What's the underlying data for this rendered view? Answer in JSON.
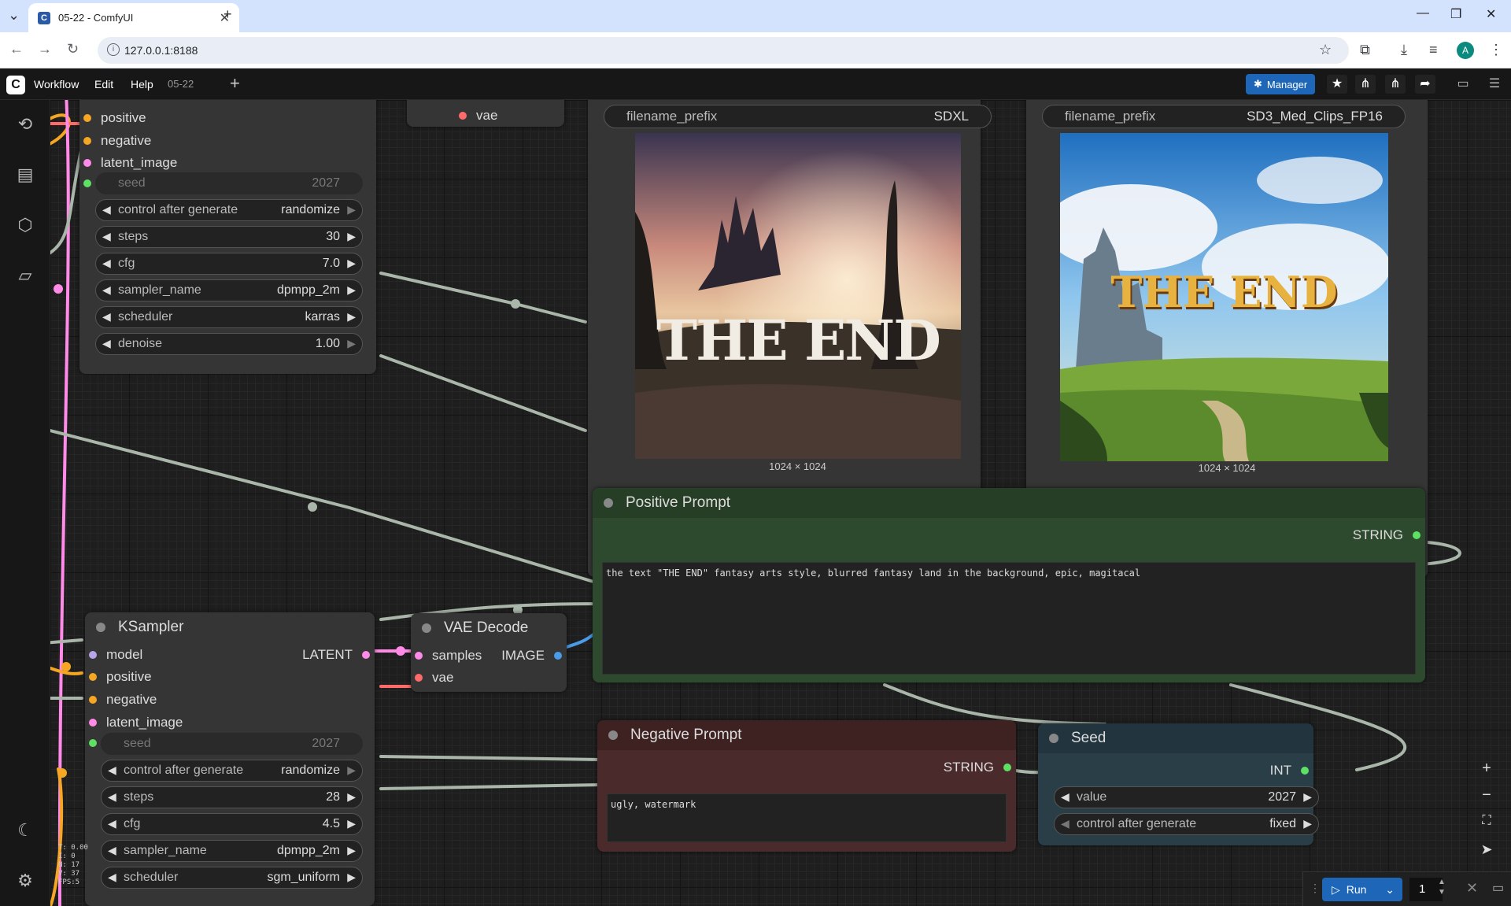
{
  "browser": {
    "tab_title": "05-22 - ComfyUI",
    "url": "127.0.0.1:8188",
    "profile_initial": "A"
  },
  "menu": {
    "items": [
      "Workflow",
      "Edit",
      "Help"
    ],
    "workflow_tab": "05-22",
    "manager_label": "Manager"
  },
  "ksampler_top": {
    "inputs": [
      "positive",
      "negative",
      "latent_image"
    ],
    "widgets": [
      {
        "label": "seed",
        "value": "2027",
        "disabled": true
      },
      {
        "label": "control after generate",
        "value": "randomize"
      },
      {
        "label": "steps",
        "value": "30"
      },
      {
        "label": "cfg",
        "value": "7.0"
      },
      {
        "label": "sampler_name",
        "value": "dpmpp_2m"
      },
      {
        "label": "scheduler",
        "value": "karras"
      },
      {
        "label": "denoise",
        "value": "1.00"
      }
    ]
  },
  "vae_top": {
    "input": "vae"
  },
  "save_sdxl": {
    "widget_label": "filename_prefix",
    "widget_value": "SDXL",
    "caption": "1024 × 1024"
  },
  "save_sd3": {
    "widget_label": "filename_prefix",
    "widget_value": "SD3_Med_Clips_FP16",
    "caption": "1024 × 1024"
  },
  "positive_prompt": {
    "title": "Positive Prompt",
    "output": "STRING",
    "text": "the text \"THE END\" fantasy arts style, blurred fantasy land in the background, epic, magitacal"
  },
  "ksampler": {
    "title": "KSampler",
    "inputs": [
      "model",
      "positive",
      "negative",
      "latent_image"
    ],
    "output": "LATENT",
    "widgets": [
      {
        "label": "seed",
        "value": "2027",
        "disabled": true
      },
      {
        "label": "control after generate",
        "value": "randomize"
      },
      {
        "label": "steps",
        "value": "28"
      },
      {
        "label": "cfg",
        "value": "4.5"
      },
      {
        "label": "sampler_name",
        "value": "dpmpp_2m"
      },
      {
        "label": "scheduler",
        "value": "sgm_uniform"
      }
    ]
  },
  "vae_decode": {
    "title": "VAE Decode",
    "inputs": [
      "samples",
      "vae"
    ],
    "output": "IMAGE"
  },
  "negative_prompt": {
    "title": "Negative Prompt",
    "output": "STRING",
    "text": "ugly, watermark"
  },
  "seed_node": {
    "title": "Seed",
    "output": "INT",
    "widgets": [
      {
        "label": "value",
        "value": "2027"
      },
      {
        "label": "control after generate",
        "value": "fixed"
      }
    ]
  },
  "image_sdxl_text": "THE END",
  "image_sd3_text": "THE END",
  "run": {
    "label": "Run",
    "count": "1"
  },
  "stats_lines": [
    "T: 0.00",
    "I: 0",
    "N: 17",
    "V: 37",
    "FPS:5"
  ],
  "colors": {
    "positive_node": "#2e4a2e",
    "negative_node": "#4a2a2a",
    "seed_node": "#2a3e48",
    "accent": "#1e67b8",
    "wire_default": "#a9b6a9",
    "wire_latent": "#ff8ae8",
    "wire_image": "#4a9be8",
    "slot_positive": "#f5a623",
    "slot_vae": "#ff6b6b",
    "slot_model": "#b8a4e8",
    "slot_int": "#5de063"
  },
  "icons": [
    "history-icon",
    "queue-icon",
    "model-library-icon",
    "workflows-icon",
    "theme-icon",
    "settings-icon"
  ]
}
